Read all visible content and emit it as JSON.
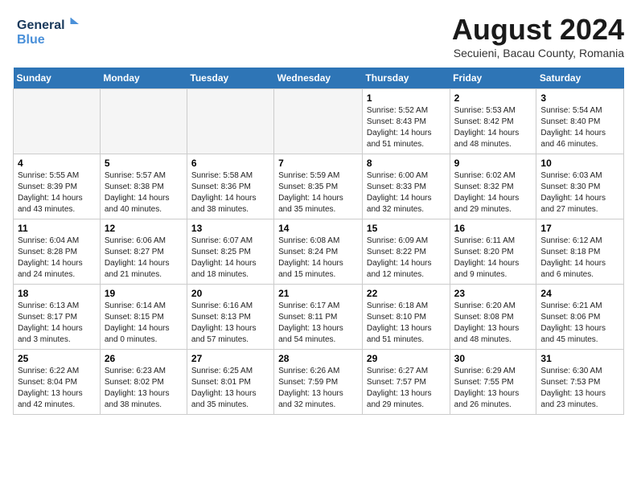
{
  "header": {
    "logo_line1": "General",
    "logo_line2": "Blue",
    "month_title": "August 2024",
    "subtitle": "Secuieni, Bacau County, Romania"
  },
  "days_of_week": [
    "Sunday",
    "Monday",
    "Tuesday",
    "Wednesday",
    "Thursday",
    "Friday",
    "Saturday"
  ],
  "weeks": [
    [
      {
        "day": "",
        "info": "",
        "empty": true
      },
      {
        "day": "",
        "info": "",
        "empty": true
      },
      {
        "day": "",
        "info": "",
        "empty": true
      },
      {
        "day": "",
        "info": "",
        "empty": true
      },
      {
        "day": "1",
        "info": "Sunrise: 5:52 AM\nSunset: 8:43 PM\nDaylight: 14 hours\nand 51 minutes."
      },
      {
        "day": "2",
        "info": "Sunrise: 5:53 AM\nSunset: 8:42 PM\nDaylight: 14 hours\nand 48 minutes."
      },
      {
        "day": "3",
        "info": "Sunrise: 5:54 AM\nSunset: 8:40 PM\nDaylight: 14 hours\nand 46 minutes."
      }
    ],
    [
      {
        "day": "4",
        "info": "Sunrise: 5:55 AM\nSunset: 8:39 PM\nDaylight: 14 hours\nand 43 minutes."
      },
      {
        "day": "5",
        "info": "Sunrise: 5:57 AM\nSunset: 8:38 PM\nDaylight: 14 hours\nand 40 minutes."
      },
      {
        "day": "6",
        "info": "Sunrise: 5:58 AM\nSunset: 8:36 PM\nDaylight: 14 hours\nand 38 minutes."
      },
      {
        "day": "7",
        "info": "Sunrise: 5:59 AM\nSunset: 8:35 PM\nDaylight: 14 hours\nand 35 minutes."
      },
      {
        "day": "8",
        "info": "Sunrise: 6:00 AM\nSunset: 8:33 PM\nDaylight: 14 hours\nand 32 minutes."
      },
      {
        "day": "9",
        "info": "Sunrise: 6:02 AM\nSunset: 8:32 PM\nDaylight: 14 hours\nand 29 minutes."
      },
      {
        "day": "10",
        "info": "Sunrise: 6:03 AM\nSunset: 8:30 PM\nDaylight: 14 hours\nand 27 minutes."
      }
    ],
    [
      {
        "day": "11",
        "info": "Sunrise: 6:04 AM\nSunset: 8:28 PM\nDaylight: 14 hours\nand 24 minutes."
      },
      {
        "day": "12",
        "info": "Sunrise: 6:06 AM\nSunset: 8:27 PM\nDaylight: 14 hours\nand 21 minutes."
      },
      {
        "day": "13",
        "info": "Sunrise: 6:07 AM\nSunset: 8:25 PM\nDaylight: 14 hours\nand 18 minutes."
      },
      {
        "day": "14",
        "info": "Sunrise: 6:08 AM\nSunset: 8:24 PM\nDaylight: 14 hours\nand 15 minutes."
      },
      {
        "day": "15",
        "info": "Sunrise: 6:09 AM\nSunset: 8:22 PM\nDaylight: 14 hours\nand 12 minutes."
      },
      {
        "day": "16",
        "info": "Sunrise: 6:11 AM\nSunset: 8:20 PM\nDaylight: 14 hours\nand 9 minutes."
      },
      {
        "day": "17",
        "info": "Sunrise: 6:12 AM\nSunset: 8:18 PM\nDaylight: 14 hours\nand 6 minutes."
      }
    ],
    [
      {
        "day": "18",
        "info": "Sunrise: 6:13 AM\nSunset: 8:17 PM\nDaylight: 14 hours\nand 3 minutes."
      },
      {
        "day": "19",
        "info": "Sunrise: 6:14 AM\nSunset: 8:15 PM\nDaylight: 14 hours\nand 0 minutes."
      },
      {
        "day": "20",
        "info": "Sunrise: 6:16 AM\nSunset: 8:13 PM\nDaylight: 13 hours\nand 57 minutes."
      },
      {
        "day": "21",
        "info": "Sunrise: 6:17 AM\nSunset: 8:11 PM\nDaylight: 13 hours\nand 54 minutes."
      },
      {
        "day": "22",
        "info": "Sunrise: 6:18 AM\nSunset: 8:10 PM\nDaylight: 13 hours\nand 51 minutes."
      },
      {
        "day": "23",
        "info": "Sunrise: 6:20 AM\nSunset: 8:08 PM\nDaylight: 13 hours\nand 48 minutes."
      },
      {
        "day": "24",
        "info": "Sunrise: 6:21 AM\nSunset: 8:06 PM\nDaylight: 13 hours\nand 45 minutes."
      }
    ],
    [
      {
        "day": "25",
        "info": "Sunrise: 6:22 AM\nSunset: 8:04 PM\nDaylight: 13 hours\nand 42 minutes."
      },
      {
        "day": "26",
        "info": "Sunrise: 6:23 AM\nSunset: 8:02 PM\nDaylight: 13 hours\nand 38 minutes."
      },
      {
        "day": "27",
        "info": "Sunrise: 6:25 AM\nSunset: 8:01 PM\nDaylight: 13 hours\nand 35 minutes."
      },
      {
        "day": "28",
        "info": "Sunrise: 6:26 AM\nSunset: 7:59 PM\nDaylight: 13 hours\nand 32 minutes."
      },
      {
        "day": "29",
        "info": "Sunrise: 6:27 AM\nSunset: 7:57 PM\nDaylight: 13 hours\nand 29 minutes."
      },
      {
        "day": "30",
        "info": "Sunrise: 6:29 AM\nSunset: 7:55 PM\nDaylight: 13 hours\nand 26 minutes."
      },
      {
        "day": "31",
        "info": "Sunrise: 6:30 AM\nSunset: 7:53 PM\nDaylight: 13 hours\nand 23 minutes."
      }
    ]
  ]
}
